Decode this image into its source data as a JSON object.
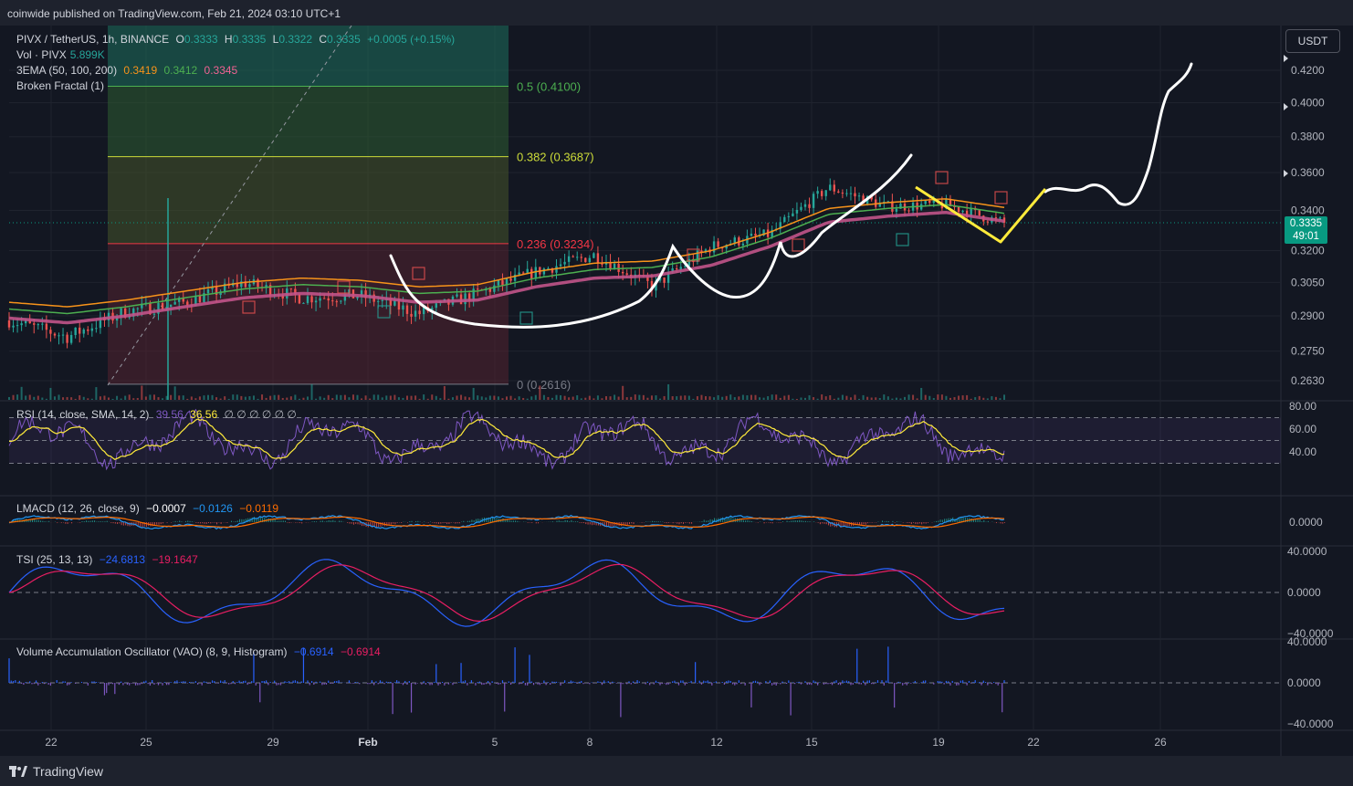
{
  "header": {
    "published_by": "coinwide published on TradingView.com, Feb 21, 2024 03:10 UTC+1"
  },
  "footer": {
    "brand": "TradingView"
  },
  "legend": {
    "symbol": "PIVX / TetherUS, 1h, BINANCE",
    "ohlc": [
      {
        "label": "O",
        "value": "0.3333"
      },
      {
        "label": "H",
        "value": "0.3335"
      },
      {
        "label": "L",
        "value": "0.3322"
      },
      {
        "label": "C",
        "value": "0.3335"
      }
    ],
    "change": "+0.0005 (+0.15%)",
    "vol_label": "Vol · PIVX",
    "vol_value": "5.899K",
    "ema_label": "3EMA (50, 100, 200)",
    "ema_values": [
      "0.3419",
      "0.3412",
      "0.3345"
    ],
    "fractal_label": "Broken Fractal (1)"
  },
  "colors": {
    "up": "#26a69a",
    "down": "#ef5350",
    "ema50": "#f7931a",
    "ema100": "#4caf50",
    "ema200": "#c2548a",
    "rsi": "#7e57c2",
    "rsi_ma": "#ffeb3b",
    "macd": "#2196f3",
    "signal": "#ff6d00",
    "tsi": "#2962ff",
    "tsi_signal": "#e91e63",
    "drawing_white": "#ffffff",
    "drawing_yellow": "#ffeb3b",
    "price_tag": "#089981"
  },
  "currency_button": "USDT",
  "last_price": {
    "price": "0.3335",
    "countdown": "49:01"
  },
  "fib_levels": [
    {
      "label": "0.5 (0.4100)",
      "price": 0.41,
      "color": "#4caf50"
    },
    {
      "label": "0.382 (0.3687)",
      "price": 0.3687,
      "color": "#cddc39"
    },
    {
      "label": "0.236 (0.3234)",
      "price": 0.3234,
      "color": "#f23645"
    },
    {
      "label": "0 (0.2616)",
      "price": 0.2616,
      "color": "#787b86"
    }
  ],
  "rsi_legend": {
    "label": "RSI (14, close, SMA, 14, 2)",
    "values": [
      "39.56",
      "36.56"
    ],
    "extra": "∅ ∅ ∅ ∅ ∅ ∅"
  },
  "macd_legend": {
    "label": "LMACD (12, 26, close, 9)",
    "values": [
      "−0.0007",
      "−0.0126",
      "−0.0119"
    ]
  },
  "tsi_legend": {
    "label": "TSI (25, 13, 13)",
    "values": [
      "−24.6813",
      "−19.1647"
    ]
  },
  "vao_legend": {
    "label": "Volume Accumulation Oscillator (VAO) (8, 9, Histogram)",
    "values": [
      "−0.6914",
      "−0.6914"
    ]
  },
  "chart_data": {
    "type": "line",
    "title": "PIVX / TetherUS, 1h, BINANCE",
    "x_ticks": [
      "22",
      "25",
      "29",
      "Feb",
      "5",
      "8",
      "12",
      "15",
      "19",
      "22",
      "26"
    ],
    "price_ticks": [
      "0.4200",
      "0.4000",
      "0.3800",
      "0.3600",
      "0.3400",
      "0.3200",
      "0.3050",
      "0.2900",
      "0.2750",
      "0.2630"
    ],
    "price_scale": "log",
    "price_range": [
      0.255,
      0.43
    ],
    "series": [
      {
        "name": "PIVX close (approx)",
        "x": [
          "Jan 20",
          "Jan 23",
          "Jan 25",
          "Jan 27",
          "Jan 30",
          "Feb 1",
          "Feb 3",
          "Feb 5",
          "Feb 7",
          "Feb 9",
          "Feb 10",
          "Feb 12",
          "Feb 14",
          "Feb 16",
          "Feb 18",
          "Feb 19",
          "Feb 20",
          "Feb 21"
        ],
        "values": [
          0.288,
          0.281,
          0.292,
          0.296,
          0.305,
          0.298,
          0.299,
          0.291,
          0.3,
          0.31,
          0.318,
          0.303,
          0.322,
          0.328,
          0.352,
          0.342,
          0.343,
          0.3335
        ]
      },
      {
        "name": "3EMA (50, 100, 200)",
        "values": [
          0.289,
          0.287,
          0.29,
          0.294,
          0.298,
          0.3,
          0.299,
          0.296,
          0.297,
          0.303,
          0.307,
          0.308,
          0.313,
          0.322,
          0.334,
          0.337,
          0.339,
          0.3345
        ]
      }
    ],
    "rsi_ticks": [
      "80.00",
      "60.00",
      "40.00"
    ],
    "macd_ticks": [
      "0.0000"
    ],
    "tsi_ticks": [
      "40.0000",
      "0.0000",
      "−40.0000"
    ],
    "vao_ticks": [
      "40.0000",
      "0.0000",
      "−40.0000"
    ]
  }
}
